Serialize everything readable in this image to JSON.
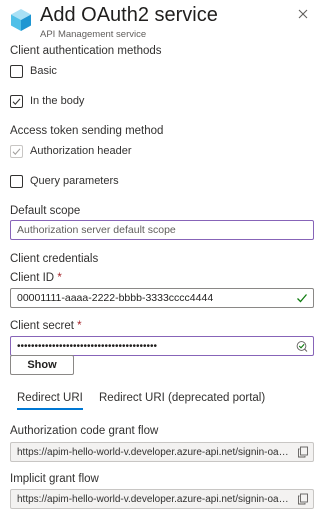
{
  "header": {
    "title": "Add OAuth2 service",
    "subtitle": "API Management service",
    "icon": "cube-icon",
    "close_icon": "close-icon"
  },
  "client_auth": {
    "label": "Client authentication methods",
    "options": [
      {
        "label": "Basic",
        "checked": false,
        "disabled": false
      },
      {
        "label": "In the body",
        "checked": true,
        "disabled": false
      }
    ]
  },
  "token_method": {
    "label": "Access token sending method",
    "options": [
      {
        "label": "Authorization header",
        "checked": true,
        "disabled": true
      },
      {
        "label": "Query parameters",
        "checked": false,
        "disabled": false
      }
    ]
  },
  "default_scope": {
    "label": "Default scope",
    "placeholder": "Authorization server default scope",
    "value": ""
  },
  "client_credentials": {
    "label": "Client credentials",
    "client_id": {
      "label": "Client ID",
      "required_marker": "*",
      "value": "00001111-aaaa-2222-bbbb-3333cccc4444",
      "status_icon": "checkmark-icon"
    },
    "client_secret": {
      "label": "Client secret",
      "required_marker": "*",
      "masked_value": "••••••••••••••••••••••••••••••••••••••••",
      "status_icon": "valid-edit-icon"
    },
    "show_button": "Show"
  },
  "redirect_tabs": {
    "tabs": [
      {
        "label": "Redirect URI",
        "active": true
      },
      {
        "label": "Redirect URI (deprecated portal)",
        "active": false
      }
    ]
  },
  "grant_flows": {
    "auth_code": {
      "label": "Authorization code grant flow",
      "url": "https://apim-hello-world-v.developer.azure-api.net/signin-oauth/code/callback",
      "copy_icon": "copy-icon"
    },
    "implicit": {
      "label": "Implicit grant flow",
      "url": "https://apim-hello-world-v.developer.azure-api.net/signin-oauth/implicit/callback",
      "copy_icon": "copy-icon"
    }
  },
  "colors": {
    "accent": "#0078d4",
    "focus_border": "#8764b8",
    "success": "#107c10",
    "required": "#a4262c"
  }
}
